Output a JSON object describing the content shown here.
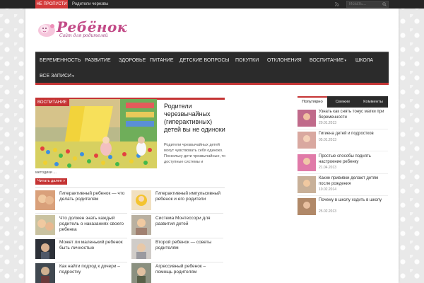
{
  "topbar": {
    "badge": "НЕ ПРОПУСТИ",
    "link": "Родители черезвы",
    "search_placeholder": "Искать..."
  },
  "logo": {
    "title": "Ребёнок",
    "subtitle": "Сайт для родителей"
  },
  "nav": {
    "row1": [
      {
        "label": "БЕРЕМЕННОСТЬ"
      },
      {
        "label": "РАЗВИТИЕ"
      },
      {
        "label": "ЗДОРОВЬЕ"
      },
      {
        "label": "ПИТАНИЕ"
      },
      {
        "label": "ДЕТСКИЕ ВОПРОСЫ"
      },
      {
        "label": "ПОКУПКИ"
      },
      {
        "label": "ОТКЛОНЕНИЯ"
      },
      {
        "label": "ВОСПИТАНИЕ",
        "caret": "▾"
      },
      {
        "label": "ШКОЛА"
      }
    ],
    "row2": [
      {
        "label": "ВСЕ ЗАПИСИ",
        "caret": "▾"
      }
    ]
  },
  "featured": {
    "category": "ВОСПИТАНИЕ",
    "title": "Родители черезвычайных (гиперактивных) детей вы не одиноки",
    "excerpt": "Родители чрезвычайных детей могут чувствовать себя одиноко. Поскольку дети чрезвычайные, то доступные системы и",
    "excerpt_tail": "методики ...",
    "read_more": "Читать далее »"
  },
  "posts": [
    {
      "title": "Гиперактивный ребенок — что делать родителям"
    },
    {
      "title": "Гиперактивный импульсивный ребенок и его родители"
    },
    {
      "title": "Что должен знать каждый родитель о наказаниях своего ребенка"
    },
    {
      "title": "Система Монтессори для развития детей"
    },
    {
      "title": "Может ли маленький ребенок быть личностью"
    },
    {
      "title": "Второй ребенок — советы родителям"
    },
    {
      "title": "Как найти подход к дочери – подростку"
    },
    {
      "title": "Агрессивный ребенок – помощь родителям"
    }
  ],
  "sidebar": {
    "tabs": [
      {
        "label": "Популярно"
      },
      {
        "label": "Свежие"
      },
      {
        "label": "Комменты"
      }
    ],
    "items": [
      {
        "title": "Узнать как снять тонус матки при беременности",
        "date": "20.01.2013"
      },
      {
        "title": "Гигиена детей и подростков",
        "date": "05.01.2013"
      },
      {
        "title": "Простые способы поднять настроение ребенку",
        "date": "21.04.2013"
      },
      {
        "title": "Какие прививки делают детям после рождения",
        "date": "10.02.2014"
      },
      {
        "title": "Почему в школу ходить в школу",
        "date": "25.02.2013"
      }
    ]
  },
  "colors": {
    "accent": "#c53434",
    "nav_bg": "#2b2b2b",
    "logo_pink": "#c24a87"
  }
}
